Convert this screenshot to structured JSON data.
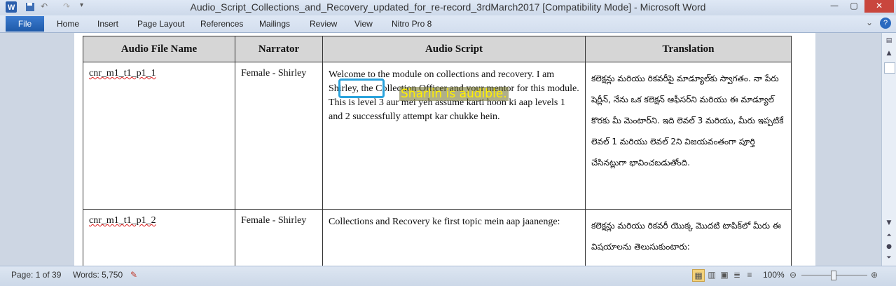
{
  "window": {
    "title": "Audio_Script_Collections_and_Recovery_updated_for_re-record_3rdMarch2017 [Compatibility Mode]  -  Microsoft Word",
    "minimize": "—",
    "maximize": "▢",
    "close": "✕"
  },
  "ribbon": {
    "file": "File",
    "tabs": [
      "Home",
      "Insert",
      "Page Layout",
      "References",
      "Mailings",
      "Review",
      "View",
      "Nitro Pro 8"
    ]
  },
  "table": {
    "headers": [
      "Audio File Name",
      "Narrator",
      "Audio Script",
      "Translation"
    ],
    "rows": [
      {
        "file": "cnr_m1_t1_p1_1",
        "narrator": "Female - Shirley",
        "script": "Welcome to the module on collections and recovery. I am Shirley, the Collection Officer and your mentor for this module. This is level 3 aur mei yeh assume karti hoon ki aap levels 1 and 2 successfully attempt kar chukke hein.",
        "translation": "కలెక్షన్లు మరియు రికవరీపై మాడ్యూల్‌కు స్వాగతం. నా పేరు షెర్లీన్, నేను ఒక కలెక్షన్ ఆఫీసర్‌ని మరియు ఈ మాడ్యూల్ కొరకు మీ మెంటార్‌ని. ఇది లెవల్ 3 మరియు, మీరు ఇప్పటికే లెవల్ 1 మరియు లెవల్ 2ని విజయవంతంగా పూర్తి చేసినట్లుగా భావించబడుతోంది."
      },
      {
        "file": "cnr_m1_t1_p1_2",
        "narrator": "Female - Shirley",
        "script": "Collections and Recovery ke first topic mein aap jaanenge:",
        "translation": "కలెక్షన్లు మరియు రికవరీ యొక్క మొదటి టాపిక్‌లో మీరు ఈ విషయాలను తెలుసుకుంటారు:"
      }
    ]
  },
  "annotation": {
    "text": "Sharlin is audible."
  },
  "status": {
    "page": "Page: 1 of 39",
    "words": "Words: 5,750",
    "zoom": "100%"
  },
  "colors": {
    "highlight": "#29a3dc",
    "annotation_text": "#ffef00",
    "file_tab": "#2a6ac0"
  }
}
